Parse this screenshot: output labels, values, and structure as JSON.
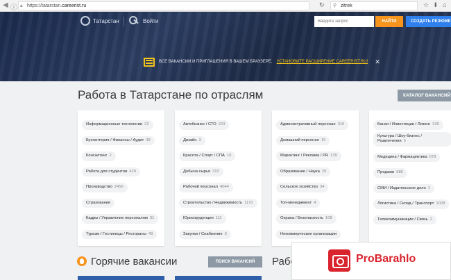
{
  "browser": {
    "url_prefix": "https://tatarstan.",
    "url_host": "careerist.ru",
    "search_value": "zitrek"
  },
  "header": {
    "region": "Татарстан",
    "login": "Войти",
    "search_placeholder": "Введите запрос",
    "find_label": "НАЙТИ",
    "resume_label": "СОЗДАТЬ РЕЗЮМЕ"
  },
  "banner": {
    "text": "ВСЕ ВАКАНСИИ И ПРИГЛАШЕНИЯ В ВАШЕМ БРАУЗЕРЕ.",
    "link": "УСТАНОВИТЕ РАСШИРЕНИЕ CAREERIST.RU!",
    "close": "✕"
  },
  "main": {
    "title": "Работа в Татарстане по отраслям",
    "catalog_label": "КАТАЛОГ ВАКАНСИЙ"
  },
  "columns": [
    [
      {
        "label": "Информационные технологии",
        "count": "22"
      },
      {
        "label": "Бухгалтерия / Финансы / Аудит",
        "count": "38"
      },
      {
        "label": "Консалтинг",
        "count": "2"
      },
      {
        "label": "Работа для студентов",
        "count": "429"
      },
      {
        "label": "Производство",
        "count": "2456"
      },
      {
        "label": "Страхование",
        "count": ""
      },
      {
        "label": "Кадры / Управление персоналом",
        "count": "31"
      },
      {
        "label": "Туризм / Гостиницы / Рестораны",
        "count": "49"
      }
    ],
    [
      {
        "label": "Автобизнес / СТО",
        "count": "223"
      },
      {
        "label": "Дизайн",
        "count": "3"
      },
      {
        "label": "Красота / Спорт / СПА",
        "count": "10"
      },
      {
        "label": "Добыча сырья",
        "count": "310"
      },
      {
        "label": "Рабочий персонал",
        "count": "4044"
      },
      {
        "label": "Строительство / Недвижимость",
        "count": "1170"
      },
      {
        "label": "Юриспруденция",
        "count": "111"
      },
      {
        "label": "Закупки / Снабжение",
        "count": "3"
      }
    ],
    [
      {
        "label": "Административный персонал",
        "count": "310"
      },
      {
        "label": "Домашний персонал",
        "count": "15"
      },
      {
        "label": "Маркетинг / Реклама / PR",
        "count": "139"
      },
      {
        "label": "Образование / Наука",
        "count": "29"
      },
      {
        "label": "Сельское хозяйство",
        "count": "34"
      },
      {
        "label": "Топ-менеджмент",
        "count": "4"
      },
      {
        "label": "Охрана / Безопасность",
        "count": "108"
      },
      {
        "label": "Некоммерческие организации",
        "count": ""
      }
    ],
    [
      {
        "label": "Банки / Инвестиции / Лизинг",
        "count": "339"
      },
      {
        "label": "Культура / Шоу-бизнес / Развлечения",
        "count": "5"
      },
      {
        "label": "Медицина / Фармацевтика",
        "count": "678"
      },
      {
        "label": "Продажи",
        "count": "686"
      },
      {
        "label": "СМИ / Издательское дело",
        "count": "1"
      },
      {
        "label": "Логистика / Склад / Транспорт",
        "count": "1028"
      },
      {
        "label": "Телекоммуникации / Связь",
        "count": "2"
      }
    ]
  ],
  "hot": {
    "title": "Горячие вакансии",
    "search_label": "ПОИСК ВАКАНСИЙ",
    "partial_title": "Рабо"
  },
  "watermark": {
    "text": "ProBarahlo"
  }
}
